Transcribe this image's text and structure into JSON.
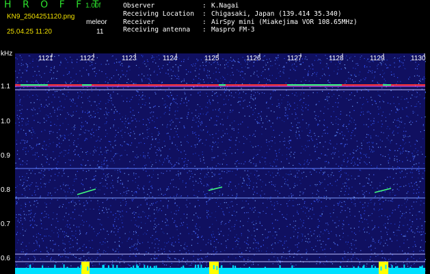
{
  "header": {
    "app_name": "H R O F F T",
    "version": "1.00f",
    "filename": "KN9_2504251120.png",
    "mode": "meleor",
    "timestamp": "25.04.25 11:20",
    "count": "11",
    "info_rows": [
      {
        "key": "Observer",
        "value": "K.Nagai"
      },
      {
        "key": "Receiving Location",
        "value": "Chigasaki, Japan (139.414 35.340)"
      },
      {
        "key": "Receiver",
        "value": "AirSpy mini (Miakejima VOR 108.65MHz)"
      },
      {
        "key": "Receiving antenna",
        "value": "Maspro FM-3"
      }
    ]
  },
  "spectrogram": {
    "y_unit": "kHz",
    "x_ticks": [
      "1121",
      "1122",
      "1123",
      "1124",
      "1125",
      "1126",
      "1127",
      "1128",
      "1129",
      "1130"
    ],
    "y_ticks": [
      "1.1",
      "1.0",
      "0.9",
      "0.8",
      "0.7",
      "0.6"
    ],
    "colors": {
      "background": "#101060",
      "noise": "#3050ff",
      "carrier": "#ff3030",
      "signal": "#40ff80",
      "level_bar": "#00e0ff",
      "level_peak": "#ffff00"
    }
  }
}
